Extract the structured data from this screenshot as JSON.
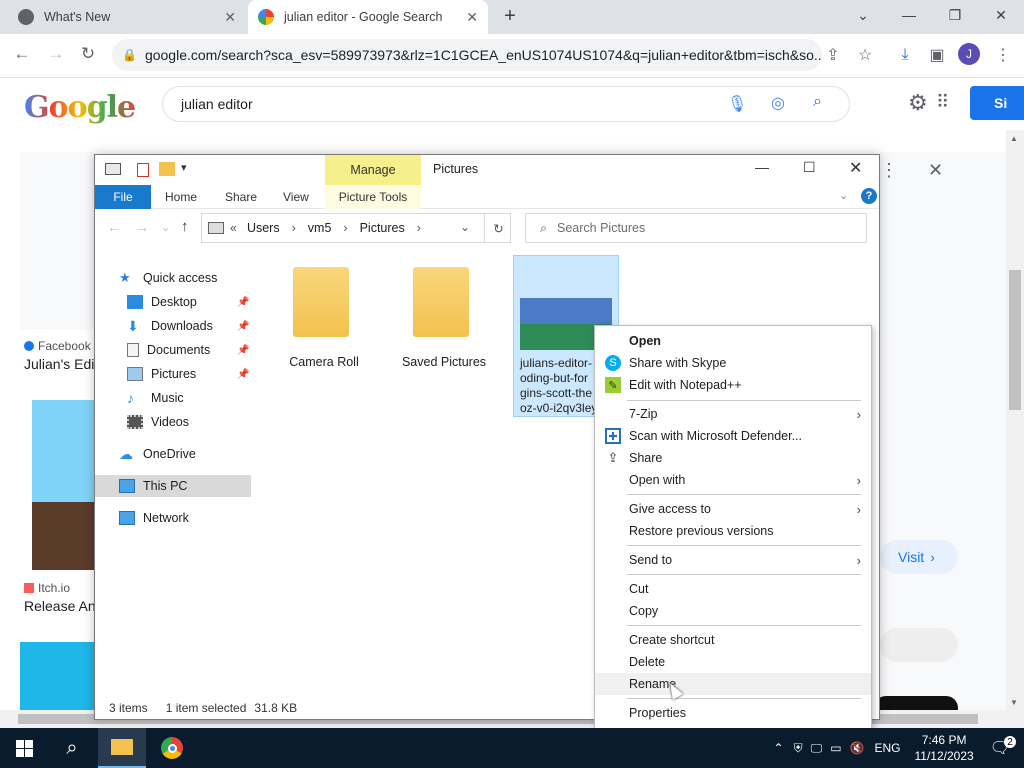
{
  "browser": {
    "tabs": [
      {
        "title": "What's New"
      },
      {
        "title": "julian editor - Google Search"
      }
    ],
    "url": "google.com/search?sca_esv=589973973&rlz=1C1GCEA_enUS1074US1074&q=julian+editor&tbm=isch&so...",
    "profile_initial": "J"
  },
  "google": {
    "logo": "Google",
    "query": "julian editor",
    "signin": "Si",
    "results": [
      {
        "source": "Facebook",
        "title": "Julian's Edi"
      },
      {
        "source": "Itch.io",
        "title": "Release An"
      }
    ],
    "visit_label": "Visit"
  },
  "explorer": {
    "title": "Pictures",
    "manage_label": "Manage",
    "ribbon_tabs": [
      "File",
      "Home",
      "Share",
      "View",
      "Picture Tools"
    ],
    "breadcrumb": [
      "Users",
      "vm5",
      "Pictures"
    ],
    "search_placeholder": "Search Pictures",
    "nav": {
      "quick_access": "Quick access",
      "desktop": "Desktop",
      "downloads": "Downloads",
      "documents": "Documents",
      "pictures": "Pictures",
      "music": "Music",
      "videos": "Videos",
      "onedrive": "OneDrive",
      "thispc": "This PC",
      "network": "Network"
    },
    "items": [
      {
        "name": "Camera Roll"
      },
      {
        "name": "Saved Pictures"
      },
      {
        "name_lines": [
          "julians-editor-",
          "oding-but-for",
          "gins-scott-the",
          "oz-v0-i2qv3ley"
        ]
      }
    ],
    "status": {
      "count": "3 items",
      "selected": "1 item selected",
      "size": "31.8 KB"
    }
  },
  "context_menu": {
    "items": [
      {
        "label": "Open"
      },
      {
        "label": "Share with Skype"
      },
      {
        "label": "Edit with Notepad++"
      },
      {
        "label": "7-Zip"
      },
      {
        "label": "Scan with Microsoft Defender..."
      },
      {
        "label": "Share"
      },
      {
        "label": "Open with"
      },
      {
        "label": "Give access to"
      },
      {
        "label": "Restore previous versions"
      },
      {
        "label": "Send to"
      },
      {
        "label": "Cut"
      },
      {
        "label": "Copy"
      },
      {
        "label": "Create shortcut"
      },
      {
        "label": "Delete"
      },
      {
        "label": "Rename"
      },
      {
        "label": "Properties"
      }
    ]
  },
  "taskbar": {
    "language": "ENG",
    "time": "7:46 PM",
    "date": "11/12/2023",
    "notifications": "2"
  },
  "colors": {
    "ribbon_file": "#1979ca",
    "manage": "#f5ef8c",
    "selection": "#cce8ff",
    "taskbar": "#0a1b2e",
    "google_blue": "#1a73e8"
  }
}
